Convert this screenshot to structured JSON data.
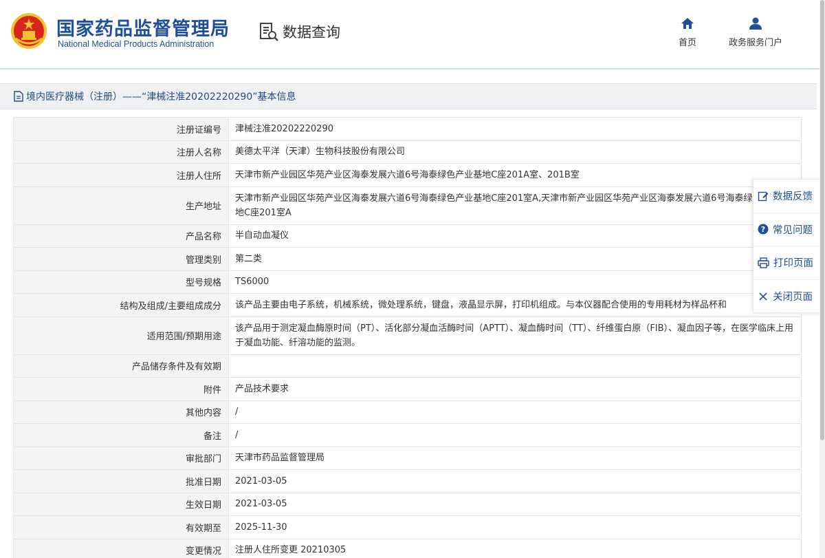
{
  "header": {
    "brand_cn": "国家药品监督管理局",
    "brand_en": "National Medical Products Administration",
    "query_label": "数据查询",
    "nav": [
      {
        "label": "首页",
        "icon": "home-icon"
      },
      {
        "label": "政务服务门户",
        "icon": "user-icon"
      }
    ]
  },
  "title_bar": {
    "text": "境内医疗器械（注册）——“津械注准20202220290”基本信息"
  },
  "fields": [
    {
      "label": "注册证编号",
      "value": "津械注准20202220290"
    },
    {
      "label": "注册人名称",
      "value": "美德太平洋（天津）生物科技股份有限公司"
    },
    {
      "label": "注册人住所",
      "value": "天津市新产业园区华苑产业区海泰发展六道6号海泰绿色产业基地C座201A室、201B室"
    },
    {
      "label": "生产地址",
      "value": "天津市新产业园区华苑产业区海泰发展六道6号海泰绿色产业基地C座201室A,天津市新产业园区华苑产业区海泰发展六道6号海泰绿色产业基地C座201室A"
    },
    {
      "label": "产品名称",
      "value": "半自动血凝仪"
    },
    {
      "label": "管理类别",
      "value": "第二类"
    },
    {
      "label": "型号规格",
      "value": "TS6000"
    },
    {
      "label": "结构及组成/主要组成成分",
      "value": "该产品主要由电子系统，机械系统，微处理系统，键盘，液晶显示屏，打印机组成。与本仪器配合使用的专用耗材为样品杯和"
    },
    {
      "label": "适用范围/预期用途",
      "value": "该产品用于测定凝血酶原时间（PT）、活化部分凝血活酶时间（APTT）、凝血酶时间（TT）、纤维蛋白原（FIB）、凝血因子等，在医学临床上用于凝血功能、纤溶功能的监测。"
    },
    {
      "label": "产品储存条件及有效期",
      "value": ""
    },
    {
      "label": "附件",
      "value": "产品技术要求"
    },
    {
      "label": "其他内容",
      "value": "/"
    },
    {
      "label": "备注",
      "value": "/"
    },
    {
      "label": "审批部门",
      "value": "天津市药品监督管理局"
    },
    {
      "label": "批准日期",
      "value": "2021-03-05"
    },
    {
      "label": "生效日期",
      "value": "2021-03-05"
    },
    {
      "label": "有效期至",
      "value": "2025-11-30"
    },
    {
      "label": "变更情况",
      "value": "注册人住所变更 20210305"
    }
  ],
  "side_panel": [
    {
      "label": "数据反馈",
      "icon": "edit-icon"
    },
    {
      "label": "常见问题",
      "icon": "question-icon"
    },
    {
      "label": "打印页面",
      "icon": "printer-icon"
    },
    {
      "label": "关闭页面",
      "icon": "close-icon"
    }
  ],
  "colors": {
    "brand": "#1f4f99",
    "title_text": "#234a84",
    "label_bg": "#f4f4f5",
    "border": "#e1e4e8",
    "emblem_red": "#d7261e",
    "emblem_gold": "#f2c230"
  }
}
